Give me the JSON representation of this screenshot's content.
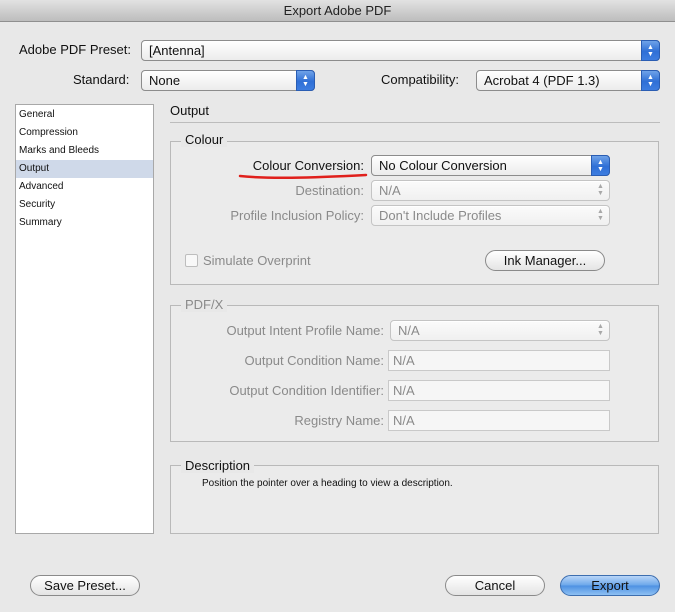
{
  "window": {
    "title": "Export Adobe PDF"
  },
  "top": {
    "preset_label": "Adobe PDF Preset:",
    "preset_value": "[Antenna]",
    "standard_label": "Standard:",
    "standard_value": "None",
    "compat_label": "Compatibility:",
    "compat_value": "Acrobat 4 (PDF 1.3)"
  },
  "sidebar": {
    "items": [
      {
        "label": "General"
      },
      {
        "label": "Compression"
      },
      {
        "label": "Marks and Bleeds"
      },
      {
        "label": "Output"
      },
      {
        "label": "Advanced"
      },
      {
        "label": "Security"
      },
      {
        "label": "Summary"
      }
    ],
    "selected": "Output"
  },
  "main": {
    "section_title": "Output",
    "colour": {
      "title": "Colour",
      "conversion_label": "Colour Conversion:",
      "conversion_value": "No Colour Conversion",
      "destination_label": "Destination:",
      "destination_value": "N/A",
      "profile_label": "Profile Inclusion Policy:",
      "profile_value": "Don't Include Profiles",
      "simulate_label": "Simulate Overprint",
      "ink_manager_label": "Ink Manager..."
    },
    "pdfx": {
      "title": "PDF/X",
      "intent_label": "Output Intent Profile Name:",
      "intent_value": "N/A",
      "condition_name_label": "Output Condition Name:",
      "condition_name_value": "N/A",
      "condition_id_label": "Output Condition Identifier:",
      "condition_id_value": "N/A",
      "registry_label": "Registry Name:",
      "registry_value": "N/A"
    },
    "description": {
      "title": "Description",
      "text": "Position the pointer over a heading to view a description."
    }
  },
  "buttons": {
    "save_preset": "Save Preset...",
    "cancel": "Cancel",
    "export": "Export"
  },
  "colors": {
    "annotation_underline": "#e0201c",
    "accent_blue": "#3d7de0",
    "sidebar_selection": "#cfd9e9"
  }
}
